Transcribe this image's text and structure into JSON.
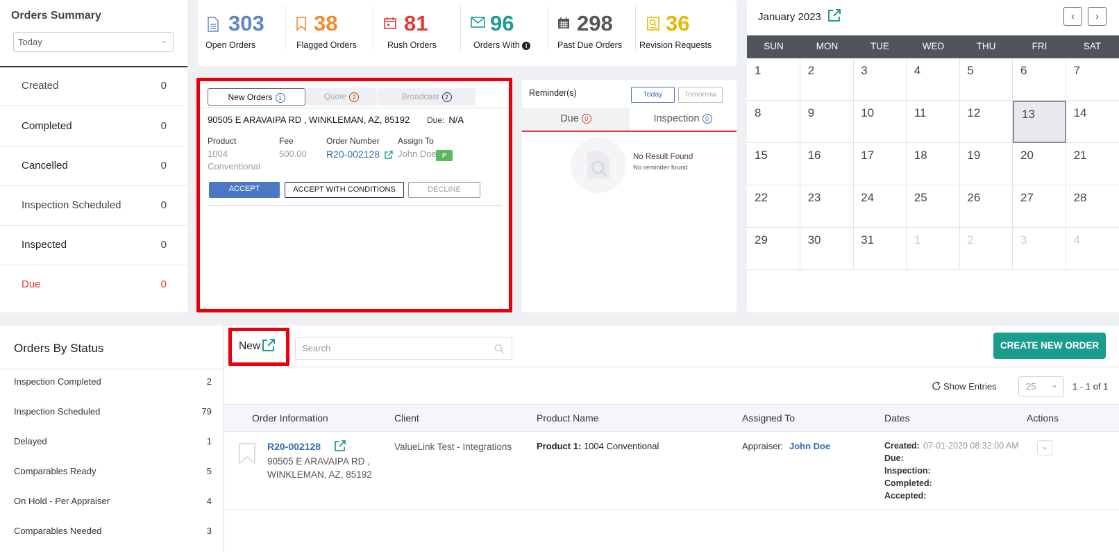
{
  "summary": {
    "title": "Orders Summary",
    "period": "Today",
    "rows": [
      {
        "label": "Created",
        "value": "0"
      },
      {
        "label": "Completed",
        "value": "0"
      },
      {
        "label": "Cancelled",
        "value": "0"
      },
      {
        "label": "Inspection Scheduled",
        "value": "0"
      },
      {
        "label": "Inspected",
        "value": "0"
      },
      {
        "label": "Due",
        "value": "0"
      }
    ]
  },
  "stats": [
    {
      "value": "303",
      "label": "Open Orders",
      "color": "#5b86c5",
      "icon": "document-icon"
    },
    {
      "value": "38",
      "label": "Flagged Orders",
      "color": "#f28b2c",
      "icon": "bookmark-icon"
    },
    {
      "value": "81",
      "label": "Rush Orders",
      "color": "#e53935",
      "icon": "calendar-icon"
    },
    {
      "value": "96",
      "label": "Orders With",
      "color": "#1a9d8f",
      "icon": "envelope-icon"
    },
    {
      "value": "298",
      "label": "Past Due Orders",
      "color": "#555555",
      "icon": "calendar-grid-icon"
    },
    {
      "value": "36",
      "label": "Revision Requests",
      "color": "#e6b800",
      "icon": "magnify-doc-icon"
    }
  ],
  "new_orders": {
    "tabs": [
      {
        "label": "New Orders",
        "count": "1"
      },
      {
        "label": "Quote",
        "count": "2"
      },
      {
        "label": "Broadcast",
        "count": "2"
      }
    ],
    "address": "90505 E ARAVAIPA RD , WINKLEMAN, AZ, 85192",
    "due_label": "Due:",
    "due_value": "N/A",
    "product_label": "Product",
    "product_value1": "1004",
    "product_value2": "Conventional",
    "fee_label": "Fee",
    "fee_value": "500.00",
    "order_number_label": "Order Number",
    "order_number": "R20-002128",
    "assign_label": "Assign To",
    "assign_value": "John Doe",
    "assign_badge": "P",
    "accept": "ACCEPT",
    "accept_conditions": "ACCEPT WITH CONDITIONS",
    "decline": "DECLINE"
  },
  "reminders": {
    "title": "Reminder(s)",
    "today": "Today",
    "tomorrow": "Tomorrow",
    "tab_due": "Due",
    "tab_due_count": "0",
    "tab_inspection": "Inspection",
    "tab_inspection_count": "0",
    "empty_title": "No Result Found",
    "empty_sub": "No reminder found"
  },
  "calendar": {
    "month": "January 2023",
    "days": [
      "SUN",
      "MON",
      "TUE",
      "WED",
      "THU",
      "FRI",
      "SAT"
    ],
    "weeks": [
      [
        "1",
        "2",
        "3",
        "4",
        "5",
        "6",
        "7"
      ],
      [
        "8",
        "9",
        "10",
        "11",
        "12",
        "13",
        "14"
      ],
      [
        "15",
        "16",
        "17",
        "18",
        "19",
        "20",
        "21"
      ],
      [
        "22",
        "23",
        "24",
        "25",
        "26",
        "27",
        "28"
      ],
      [
        "29",
        "30",
        "31",
        "1",
        "2",
        "3",
        "4"
      ]
    ],
    "today": "13"
  },
  "by_status": {
    "title": "Orders By Status",
    "rows": [
      {
        "label": "Inspection Completed",
        "count": "2"
      },
      {
        "label": "Inspection Scheduled",
        "count": "79"
      },
      {
        "label": "Delayed",
        "count": "1"
      },
      {
        "label": "Comparables Ready",
        "count": "5"
      },
      {
        "label": "On Hold - Per Appraiser",
        "count": "4"
      },
      {
        "label": "Comparables Needed",
        "count": "3"
      }
    ]
  },
  "orders": {
    "filter_label": "New",
    "search_placeholder": "Search",
    "create_button": "CREATE NEW ORDER",
    "show_entries": "Show Entries",
    "entries": "25",
    "pager": "1 - 1 of 1",
    "columns": [
      "Order Information",
      "Client",
      "Product Name",
      "Assigned To",
      "Dates",
      "Actions"
    ],
    "row": {
      "order_number": "R20-002128",
      "address1": "90505 E ARAVAIPA RD ,",
      "address2": "WINKLEMAN, AZ, 85192",
      "client": "ValueLink Test - Integrations",
      "product_label": "Product 1:",
      "product": "1004 Conventional",
      "appraiser_label": "Appraiser:",
      "appraiser": "John Doe",
      "created_label": "Created:",
      "created": "07-01-2020 08:32:00 AM",
      "due_label": "Due:",
      "inspection_label": "Inspection:",
      "completed_label": "Completed:",
      "accepted_label": "Accepted:"
    }
  }
}
